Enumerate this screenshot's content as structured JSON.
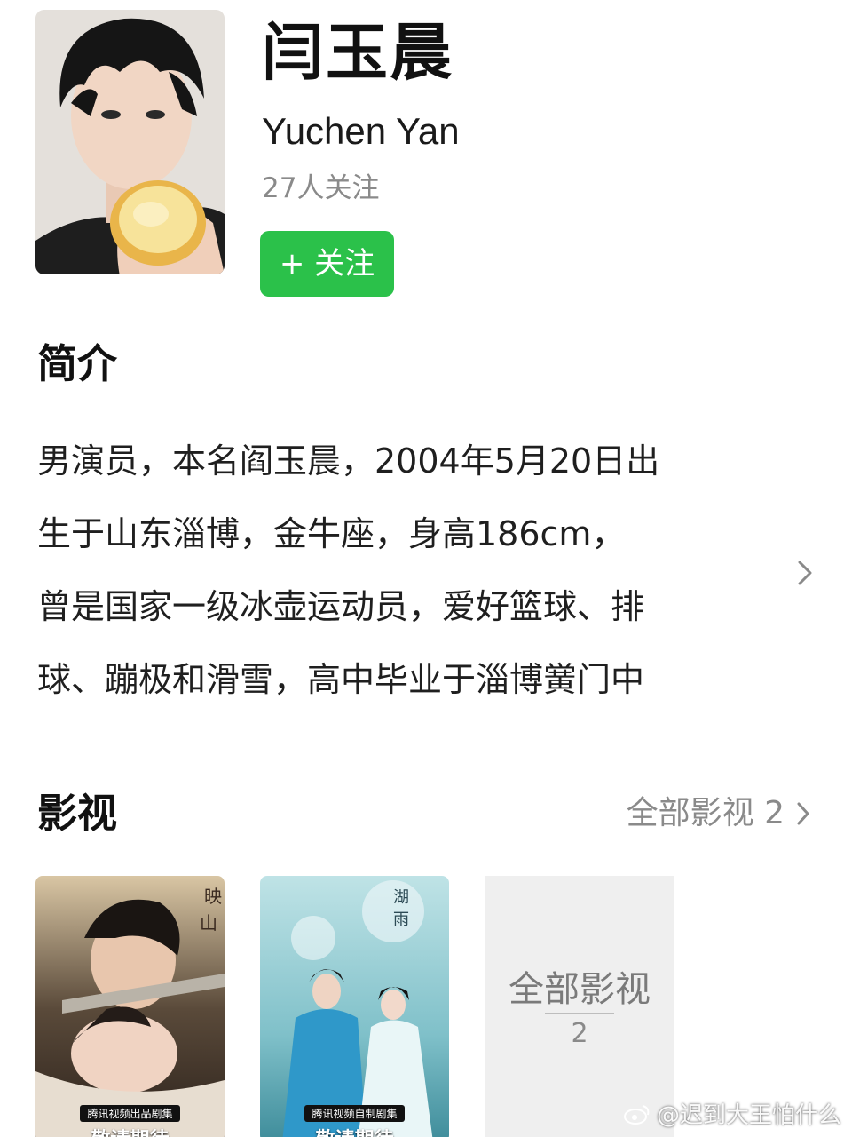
{
  "profile": {
    "name": "闫玉晨",
    "en_name": "Yuchen Yan",
    "followers": "27人关注",
    "follow_button": "+ 关注"
  },
  "intro": {
    "title": "简介",
    "lines": [
      "男演员，本名阎玉晨，2004年5月20日出",
      "生于山东淄博，金牛座，身高186cm，",
      "曾是国家一级冰壶运动员，爱好篮球、排",
      "球、蹦极和滑雪，高中毕业于淄博黉门中"
    ]
  },
  "works": {
    "title": "影视",
    "all_link": "全部影视 2",
    "posters": [
      {
        "badge_small": "腾讯视频出品剧集",
        "badge_big": "敬请期待"
      },
      {
        "badge_small": "腾讯视频自制剧集",
        "badge_big": "敬请期待"
      }
    ],
    "all_card": {
      "label": "全部影视",
      "count": "2"
    }
  },
  "watermark": "@迟到大王怕什么",
  "colors": {
    "follow_green": "#2bc14a",
    "muted_gray": "#8a8a8a"
  }
}
